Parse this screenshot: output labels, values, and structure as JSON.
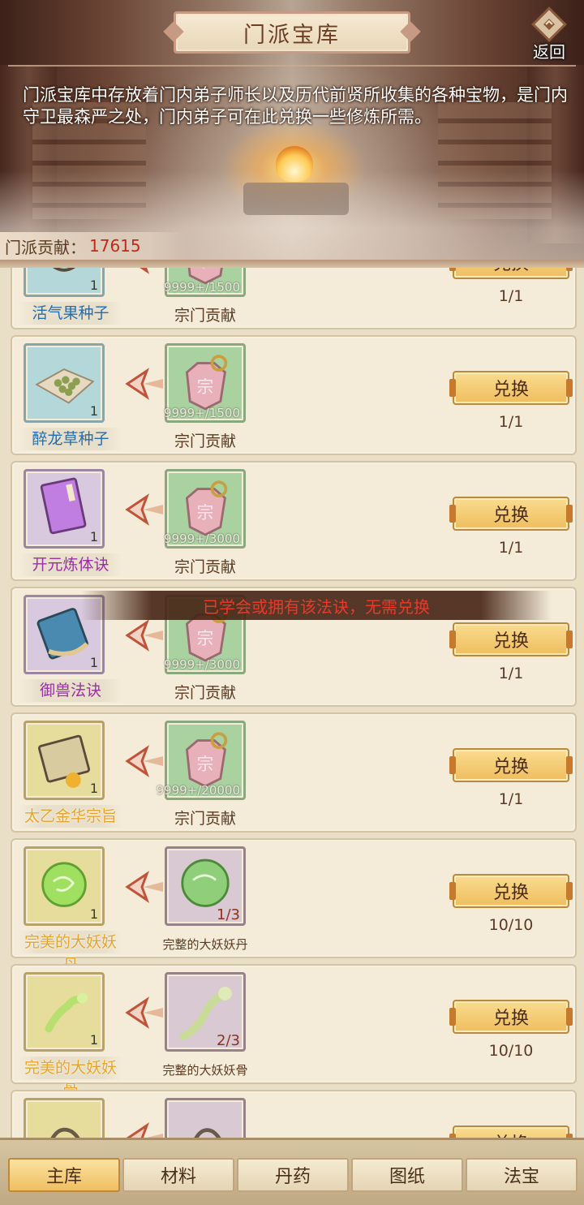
{
  "header": {
    "title": "门派宝库",
    "return_label": "返回",
    "description": "门派宝库中存放着门内弟子师长以及历代前贤所收集的各种宝物，是门内守卫最森严之处，门内弟子可在此兑换一些修炼所需。",
    "contribution_label": "门派贡献：",
    "contribution_value": "17615"
  },
  "colors": {
    "accent": "#efbf62",
    "warning_text": "#e83a2a",
    "contribution_value": "#c12a1a"
  },
  "items": [
    {
      "name": "活气果种子",
      "name_color": "blue",
      "count": "1",
      "cost_icon": "sect-token-icon",
      "cost_amount": "9999+/1500",
      "cost_name": "宗门贡献",
      "button": "兑换",
      "limit": "1/1"
    },
    {
      "name": "醉龙草种子",
      "name_color": "blue",
      "count": "1",
      "cost_icon": "sect-token-icon",
      "cost_amount": "9999+/1500",
      "cost_name": "宗门贡献",
      "button": "兑换",
      "limit": "1/1"
    },
    {
      "name": "开元炼体诀",
      "name_color": "purple",
      "count": "1",
      "cost_icon": "sect-token-icon",
      "cost_amount": "9999+/3000",
      "cost_name": "宗门贡献",
      "button": "兑换",
      "limit": "1/1"
    },
    {
      "name": "御兽法诀",
      "name_color": "purple",
      "count": "1",
      "cost_icon": "sect-token-icon",
      "cost_amount": "9999+/3000",
      "cost_name": "宗门贡献",
      "button": "兑换",
      "limit": "1/1"
    },
    {
      "name": "太乙金华宗旨",
      "name_color": "orange",
      "count": "1",
      "cost_icon": "sect-token-icon",
      "cost_amount": "9999+/20000",
      "cost_name": "宗门贡献",
      "button": "兑换",
      "limit": "1/1"
    },
    {
      "name": "完美的大妖妖丹",
      "name_color": "orange",
      "count": "1",
      "cost_icon": "demon-core-icon",
      "cost_amount": "1/3",
      "cost_name": "完整的大妖妖丹",
      "button": "兑换",
      "limit": "10/10"
    },
    {
      "name": "完美的大妖妖骨",
      "name_color": "orange",
      "count": "1",
      "cost_icon": "demon-bone-icon",
      "cost_amount": "2/3",
      "cost_name": "完整的大妖妖骨",
      "button": "兑换",
      "limit": "10/10"
    },
    {
      "name": "",
      "name_color": "orange",
      "count": "",
      "cost_icon": "demon-tendon-icon",
      "cost_amount": "",
      "cost_name": "",
      "button": "兑换",
      "limit": ""
    }
  ],
  "toast": "已学会或拥有该法诀，无需兑换",
  "tabs": [
    "主库",
    "材料",
    "丹药",
    "图纸",
    "法宝"
  ],
  "active_tab": "主库"
}
